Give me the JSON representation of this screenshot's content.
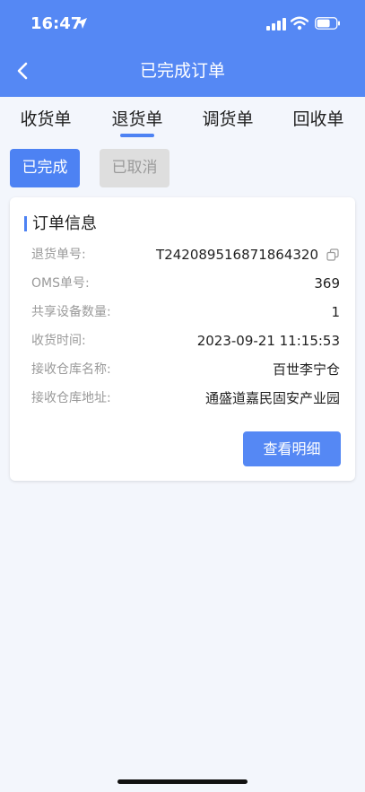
{
  "status_bar": {
    "time": "16:47"
  },
  "nav": {
    "title": "已完成订单"
  },
  "tabs": [
    {
      "label": "收货单"
    },
    {
      "label": "退货单"
    },
    {
      "label": "调货单"
    },
    {
      "label": "回收单"
    }
  ],
  "filters": {
    "active": "已完成",
    "inactive": "已取消"
  },
  "order_card": {
    "title": "订单信息",
    "fields": [
      {
        "label": "退货单号:",
        "value": "T242089516871864320"
      },
      {
        "label": "OMS单号:",
        "value": "369"
      },
      {
        "label": "共享设备数量:",
        "value": "1"
      },
      {
        "label": "收货时间:",
        "value": "2023-09-21 11:15:53"
      },
      {
        "label": "接收仓库名称:",
        "value": "百世李宁仓"
      },
      {
        "label": "接收仓库地址:",
        "value": "通盛道嘉民固安产业园"
      }
    ],
    "detail_button": "查看明细"
  },
  "colors": {
    "accent": "#5588f4",
    "tab_underline": "#4d82f3",
    "background": "#f3f6fc"
  },
  "icons": [
    "location-arrow-icon",
    "signal-icon",
    "wifi-icon",
    "battery-icon",
    "back-chevron-icon",
    "copy-icon"
  ]
}
